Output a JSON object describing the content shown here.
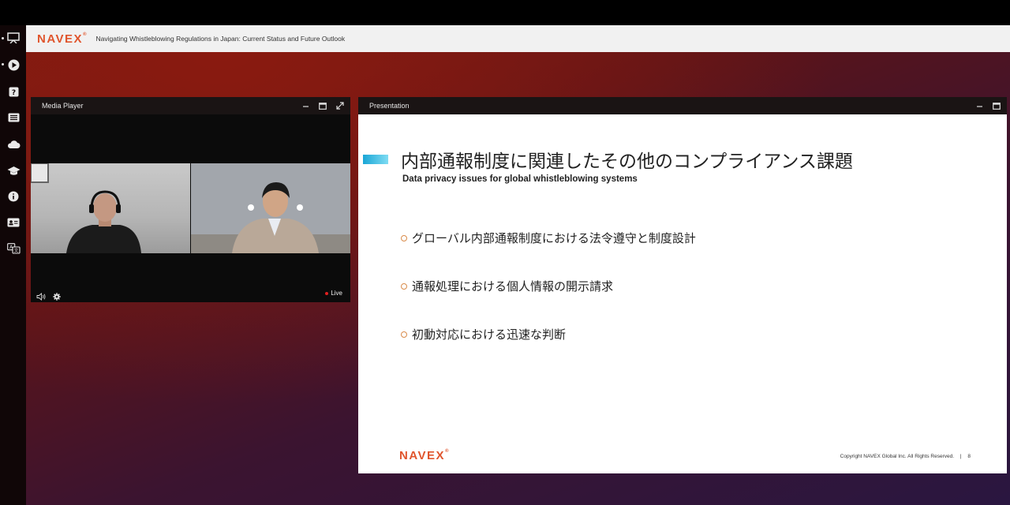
{
  "header": {
    "brand": "NAVEX",
    "title": "Navigating Whistleblowing Regulations in Japan: Current Status and Future Outlook"
  },
  "sidebar": {
    "items": [
      {
        "icon": "presentation-icon"
      },
      {
        "icon": "play-icon"
      },
      {
        "icon": "question-icon"
      },
      {
        "icon": "list-icon"
      },
      {
        "icon": "cloud-icon"
      },
      {
        "icon": "graduation-cap-icon"
      },
      {
        "icon": "info-icon"
      },
      {
        "icon": "contact-card-icon"
      },
      {
        "icon": "translate-icon"
      }
    ]
  },
  "media_player": {
    "title": "Media Player",
    "live_label": "Live"
  },
  "presentation": {
    "title": "Presentation",
    "slide": {
      "heading": "内部通報制度に関連したその他のコンプライアンス課題",
      "subheading": "Data privacy issues for global whistleblowing systems",
      "bullets": [
        "グローバル内部通報制度における法令遵守と制度設計",
        "通報処理における個人情報の開示請求",
        "初動対応における迅速な判断"
      ],
      "logo": "NAVEX",
      "copyright": "Copyright NAVEX Global Inc. All Rights Reserved.",
      "page_number": "8"
    }
  },
  "colors": {
    "brand": "#e0552d",
    "accent_bar": "#1aa6d6",
    "live": "#e02020"
  }
}
